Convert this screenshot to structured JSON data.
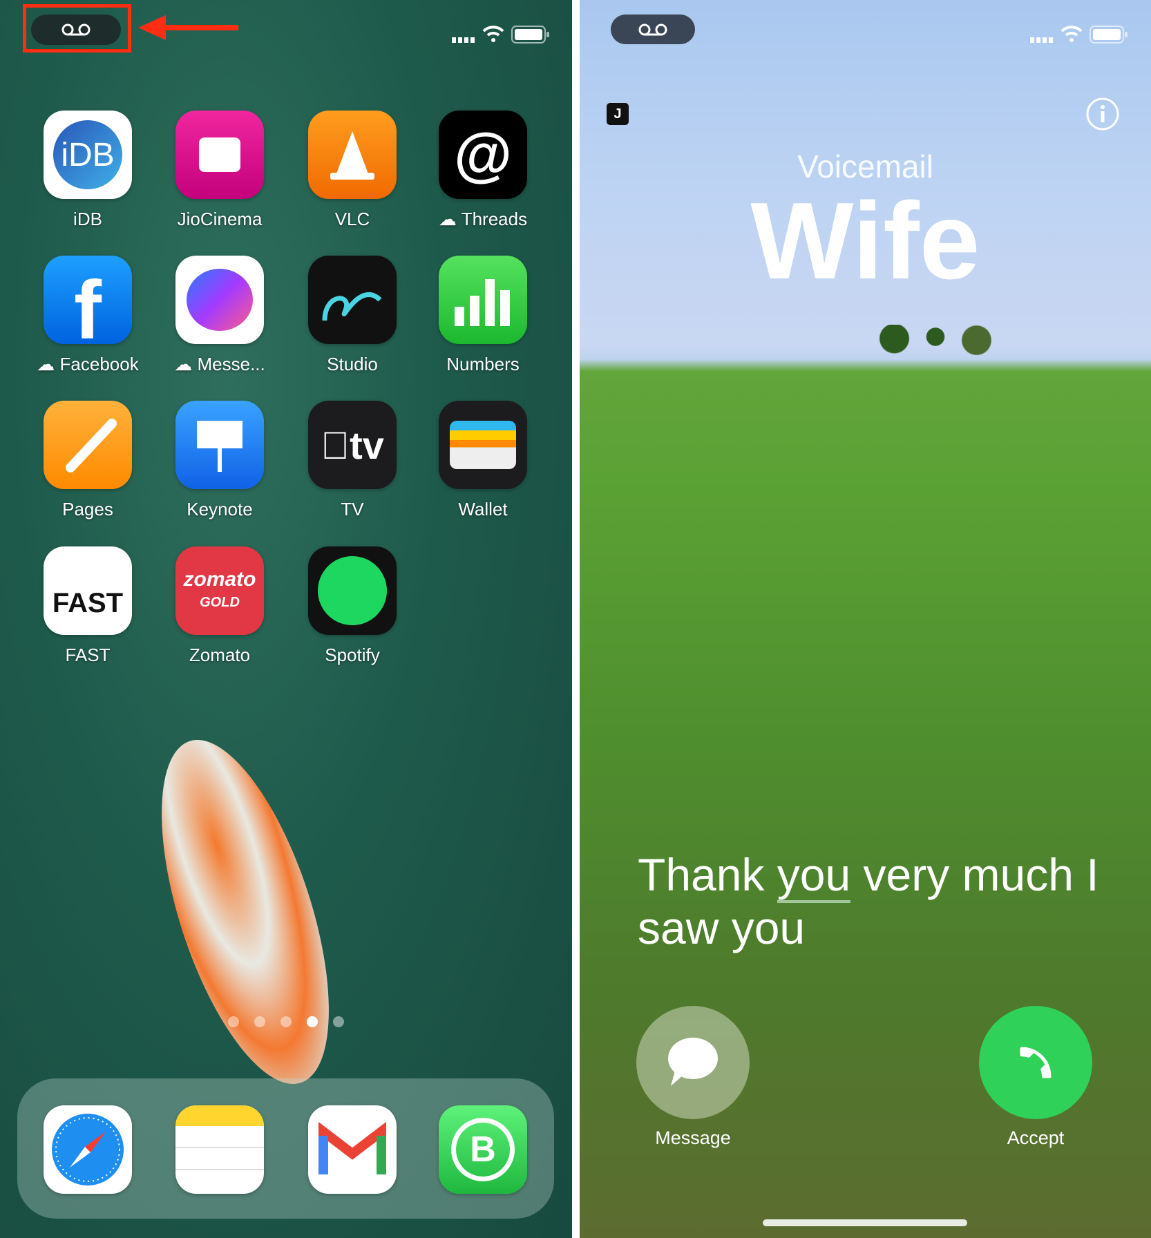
{
  "left": {
    "status": {
      "voicemail_icon": "voicemail-icon",
      "signal": "signal-icon",
      "wifi": "wifi-icon",
      "battery": "battery-icon"
    },
    "annotation_color": "#ff2d12",
    "apps": [
      {
        "label": "iDB",
        "icon_text": "iDB",
        "cloud": false
      },
      {
        "label": "JioCinema",
        "icon_text": "",
        "cloud": false
      },
      {
        "label": "VLC",
        "icon_text": "",
        "cloud": false
      },
      {
        "label": "Threads",
        "icon_text": "@",
        "cloud": true
      },
      {
        "label": "Facebook",
        "icon_text": "f",
        "cloud": true
      },
      {
        "label": "Messe...",
        "icon_text": "",
        "cloud": true
      },
      {
        "label": "Studio",
        "icon_text": "",
        "cloud": false
      },
      {
        "label": "Numbers",
        "icon_text": "",
        "cloud": false
      },
      {
        "label": "Pages",
        "icon_text": "",
        "cloud": false
      },
      {
        "label": "Keynote",
        "icon_text": "",
        "cloud": false
      },
      {
        "label": "TV",
        "icon_text": "tv",
        "cloud": false
      },
      {
        "label": "Wallet",
        "icon_text": "",
        "cloud": false
      },
      {
        "label": "FAST",
        "icon_text": "FAST",
        "cloud": false
      },
      {
        "label": "Zomato",
        "icon_text": "zomato",
        "cloud": false
      },
      {
        "label": "Spotify",
        "icon_text": "",
        "cloud": false
      }
    ],
    "zomato_sub": "GOLD",
    "page_dots": {
      "count": 5,
      "active": 4
    },
    "dock": [
      "Safari",
      "Notes",
      "Gmail",
      "WhatsApp Business"
    ],
    "dock_b": "B"
  },
  "right": {
    "badge": "J",
    "caller_type": "Voicemail",
    "caller_name": "Wife",
    "transcript_pre": "Thank ",
    "transcript_highlight": "you",
    "transcript_post": " very much I saw you",
    "message_label": "Message",
    "accept_label": "Accept",
    "accept_color": "#30d158"
  }
}
